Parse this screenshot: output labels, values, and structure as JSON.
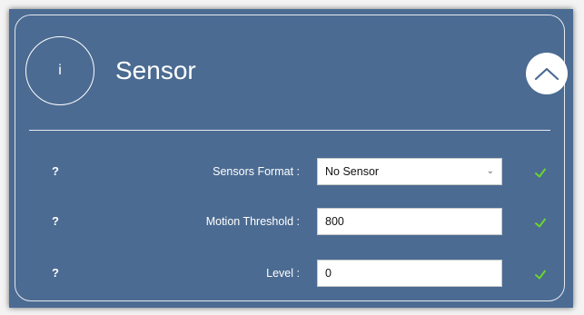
{
  "header": {
    "info_glyph": "i",
    "title": "Sensor"
  },
  "fields": [
    {
      "help": "?",
      "label": "Sensors Format :",
      "value": "No Sensor",
      "type": "select"
    },
    {
      "help": "?",
      "label": "Motion Threshold :",
      "value": "800",
      "type": "text"
    },
    {
      "help": "?",
      "label": "Level :",
      "value": "0",
      "type": "text"
    }
  ],
  "colors": {
    "panel_bg": "#4b6b92",
    "check": "#6ad62c"
  },
  "icons": {
    "info": "info-icon",
    "collapse": "chevron-up-icon",
    "valid": "checkmark-icon",
    "dropdown": "chevron-down-icon"
  }
}
